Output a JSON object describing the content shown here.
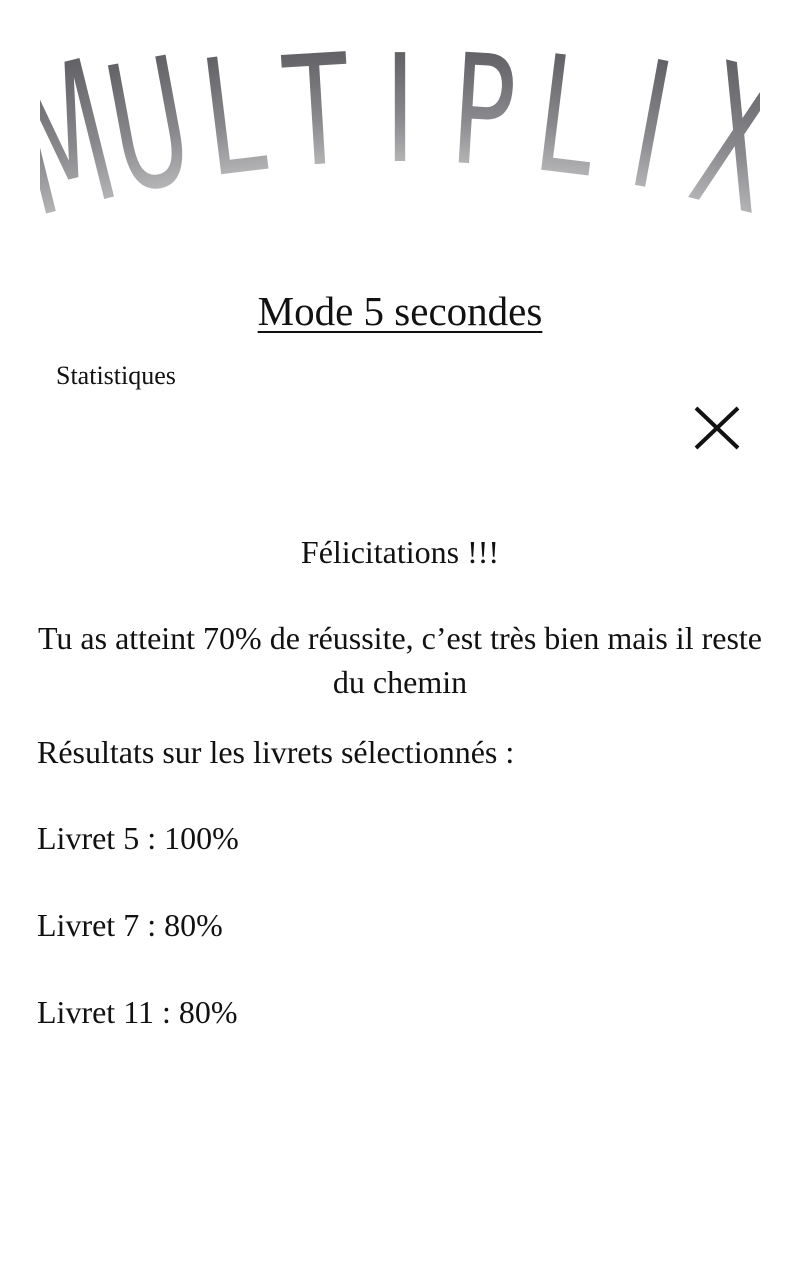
{
  "logo": {
    "text": "MULTIPLIX",
    "letters": [
      "M",
      "U",
      "L",
      "T",
      "I",
      "P",
      "L",
      "I",
      "X"
    ],
    "gradient_top": "#505055",
    "gradient_bottom": "#d6d6d8"
  },
  "header": {
    "mode_title": "Mode 5 secondes"
  },
  "nav": {
    "stats_label": "Statistiques"
  },
  "close": {
    "icon": "close-icon"
  },
  "result": {
    "congrats": "Félicitations !!!",
    "message": "Tu as atteint 70% de réussite, c’est très bien mais il reste du chemin",
    "results_heading": "Résultats sur les livrets sélectionnés :",
    "items": [
      "Livret 5 : 100%",
      "Livret 7 : 80%",
      "Livret 11 : 80%"
    ]
  }
}
